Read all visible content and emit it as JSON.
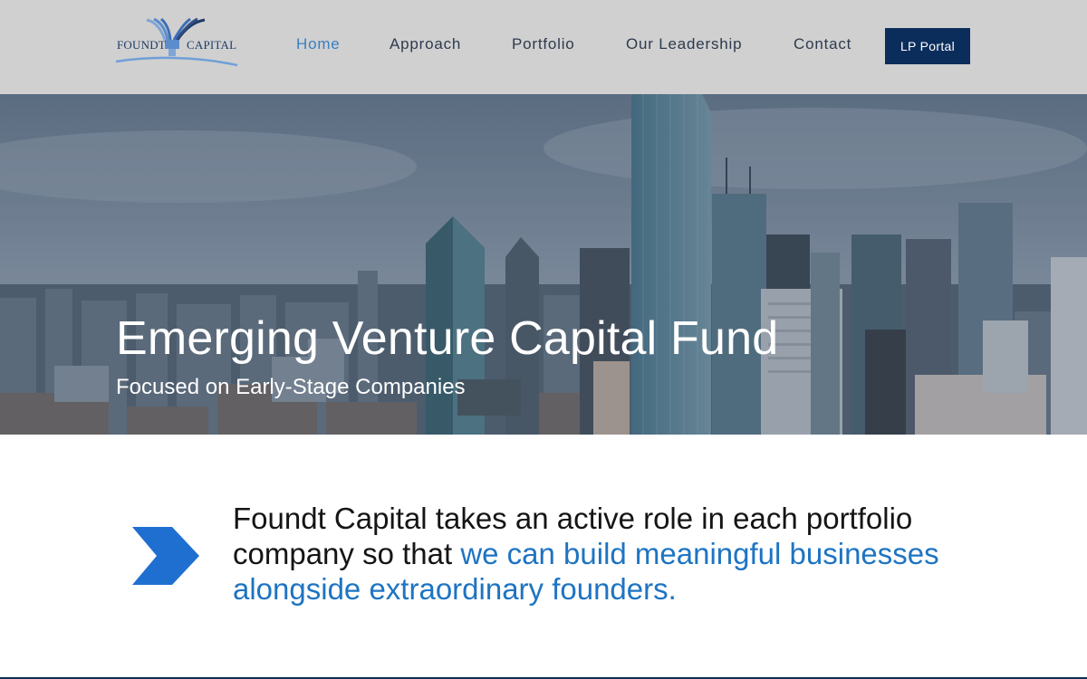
{
  "logo": {
    "text_left": "FOUNDT",
    "text_right": "CAPITAL",
    "icon": "fountain-logo-icon"
  },
  "nav": {
    "items": [
      {
        "label": "Home",
        "active": true
      },
      {
        "label": "Approach",
        "active": false
      },
      {
        "label": "Portfolio",
        "active": false
      },
      {
        "label": "Our Leadership",
        "active": false
      },
      {
        "label": "Contact",
        "active": false
      }
    ],
    "cta_label": "LP Portal"
  },
  "hero": {
    "title": "Emerging Venture Capital Fund",
    "subtitle": "Focused on Early-Stage Companies"
  },
  "mission": {
    "text_plain": "Foundt Capital takes an active role in each portfolio company so that ",
    "text_highlight": "we can build meaningful businesses alongside extraordinary founders.",
    "icon": "chevron-right-icon"
  },
  "colors": {
    "header_bg": "#d0d0d0",
    "nav_active": "#3a7fc2",
    "nav_text": "#2e3a4d",
    "cta_bg": "#0b2d5b",
    "highlight": "#1e74c2",
    "arrow": "#1f6fd1"
  }
}
